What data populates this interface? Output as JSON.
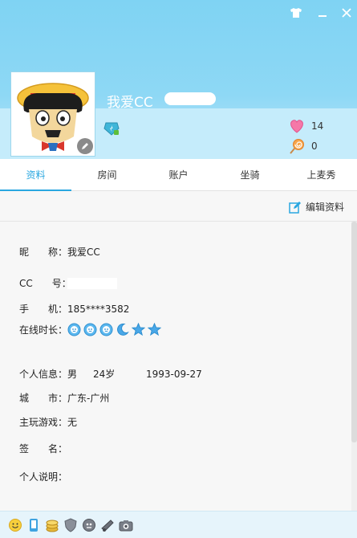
{
  "header": {
    "nickname": "我爱CC",
    "stats": [
      {
        "icon": "heart-icon",
        "value": "14"
      },
      {
        "icon": "lollipop-icon",
        "value": "0"
      }
    ]
  },
  "tabs": [
    {
      "label": "资料",
      "active": true
    },
    {
      "label": "房间",
      "active": false
    },
    {
      "label": "账户",
      "active": false
    },
    {
      "label": "坐骑",
      "active": false
    },
    {
      "label": "上麦秀",
      "active": false
    }
  ],
  "edit_profile_label": "编辑资料",
  "profile": {
    "nickname_label": "昵　　称：",
    "nickname_value": "我爱CC",
    "cc_label": "CC　　号：",
    "phone_label": "手　　机：",
    "phone_value": "185****3582",
    "online_label": "在线时长：",
    "online_icons": [
      "sun-face-icon",
      "sun-face-icon",
      "sun-face-icon",
      "moon-icon",
      "star-icon",
      "star-icon"
    ],
    "info_label": "个人信息：",
    "gender": "男",
    "age": "24岁",
    "birthday": "1993-09-27",
    "city_label": "城　　市：",
    "city_value": "广东-广州",
    "game_label": "主玩游戏：",
    "game_value": "无",
    "signature_label": "签　　名：",
    "desc_label": "个人说明："
  },
  "colors": {
    "accent": "#2aa7e0",
    "header": "#8ed8f5"
  }
}
